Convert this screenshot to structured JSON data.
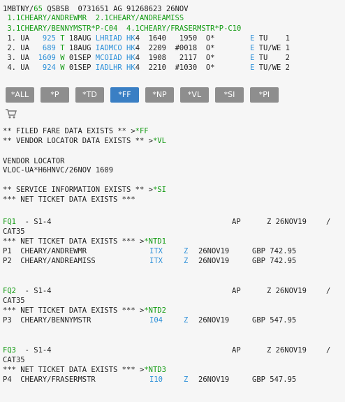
{
  "header": {
    "pnr_prefix": "1MBTNY/",
    "pnr_num": "65",
    "pnr_rest": " QSBSB  0731651 AG 91268623 26NOV"
  },
  "passengers": {
    "row1": [
      {
        "text": " 1.1CHEARY/ANDREWMR"
      },
      {
        "text": "  2.1CHEARY/ANDREAMISS"
      }
    ],
    "row2": [
      {
        "text": " 3.1CHEARY/BENNYMSTR*P-C04"
      },
      {
        "text": "  4.1CHEARY/FRASERMSTR*P-C10"
      }
    ]
  },
  "segments": [
    {
      "no": " 1.",
      "air": " UA ",
      "flt": "  925",
      "cls": " T",
      "date": " 18AUG ",
      "city": "LHRIAD",
      "st": " HK",
      "rest": "4  1640   1950  O*        ",
      "e": "E",
      "days": " TU    1"
    },
    {
      "no": " 2.",
      "air": " UA ",
      "flt": "  689",
      "cls": " T",
      "date": " 18AUG ",
      "city": "IADMCO",
      "st": " HK",
      "rest": "4  2209  #0018  O*        ",
      "e": "E",
      "days": " TU/WE 1"
    },
    {
      "no": " 3.",
      "air": " UA ",
      "flt": " 1609",
      "cls": " W",
      "date": " 01SEP ",
      "city": "MCOIAD",
      "st": " HK",
      "rest": "4  1908   2117  O*        ",
      "e": "E",
      "days": " TU    2"
    },
    {
      "no": " 4.",
      "air": " UA ",
      "flt": "  924",
      "cls": " W",
      "date": " 01SEP ",
      "city": "IADLHR",
      "st": " HK",
      "rest": "4  2210  #1030  O*        ",
      "e": "E",
      "days": " TU/WE 2"
    }
  ],
  "buttons": [
    {
      "label": "*ALL"
    },
    {
      "label": "*P"
    },
    {
      "label": "*TD"
    },
    {
      "label": "*FF"
    },
    {
      "label": "*NP"
    },
    {
      "label": "*VL"
    },
    {
      "label": "*SI"
    },
    {
      "label": "*PI"
    }
  ],
  "body": {
    "ff_line": "** FILED FARE DATA EXISTS ** >",
    "ff_link": "*FF",
    "vl_line": "** VENDOR LOCATOR DATA EXISTS ** >",
    "vl_link": "*VL",
    "vendor_title": "VENDOR LOCATOR",
    "vloc": "VLOC-UA*H6HNVC/26NOV 1609",
    "si_line": "** SERVICE INFORMATION EXISTS ** >",
    "si_link": "*SI",
    "net_line": "*** NET TICKET DATA EXISTS ***"
  },
  "fares": [
    {
      "fq": "FQ1",
      "seg": "  - S1-4",
      "ap": "AP",
      "z": "Z 26NOV19",
      "slash": "/",
      "cat": "CAT35",
      "net": "*** NET TICKET DATA EXISTS *** >",
      "ntd": "*NTD1",
      "pax": [
        {
          "p": "P1  CHEARY/ANDREWMR",
          "code": "ITX",
          "z": "Z",
          "date": "26NOV19",
          "amt": "GBP 742.95"
        },
        {
          "p": "P2  CHEARY/ANDREAMISS",
          "code": "ITX",
          "z": "Z",
          "date": "26NOV19",
          "amt": "GBP 742.95"
        }
      ]
    },
    {
      "fq": "FQ2",
      "seg": "  - S1-4",
      "ap": "AP",
      "z": "Z 26NOV19",
      "slash": "/",
      "cat": "CAT35",
      "net": "*** NET TICKET DATA EXISTS *** >",
      "ntd": "*NTD2",
      "pax": [
        {
          "p": "P3  CHEARY/BENNYMSTR",
          "code": "I04",
          "z": "Z",
          "date": "26NOV19",
          "amt": "GBP 547.95"
        }
      ]
    },
    {
      "fq": "FQ3",
      "seg": "  - S1-4",
      "ap": "AP",
      "z": "Z 26NOV19",
      "slash": "/",
      "cat": "CAT35",
      "net": "*** NET TICKET DATA EXISTS *** >",
      "ntd": "*NTD3",
      "pax": [
        {
          "p": "P4  CHEARY/FRASERMSTR",
          "code": "I10",
          "z": "Z",
          "date": "26NOV19",
          "amt": "GBP 547.95"
        }
      ]
    }
  ],
  "colors": {
    "accent_green": "#129a12",
    "accent_blue": "#2b8fd8",
    "button_gray": "#8e8e8e",
    "button_active": "#3a7fc4"
  },
  "icons": {
    "cart": "shopping-cart-icon"
  }
}
